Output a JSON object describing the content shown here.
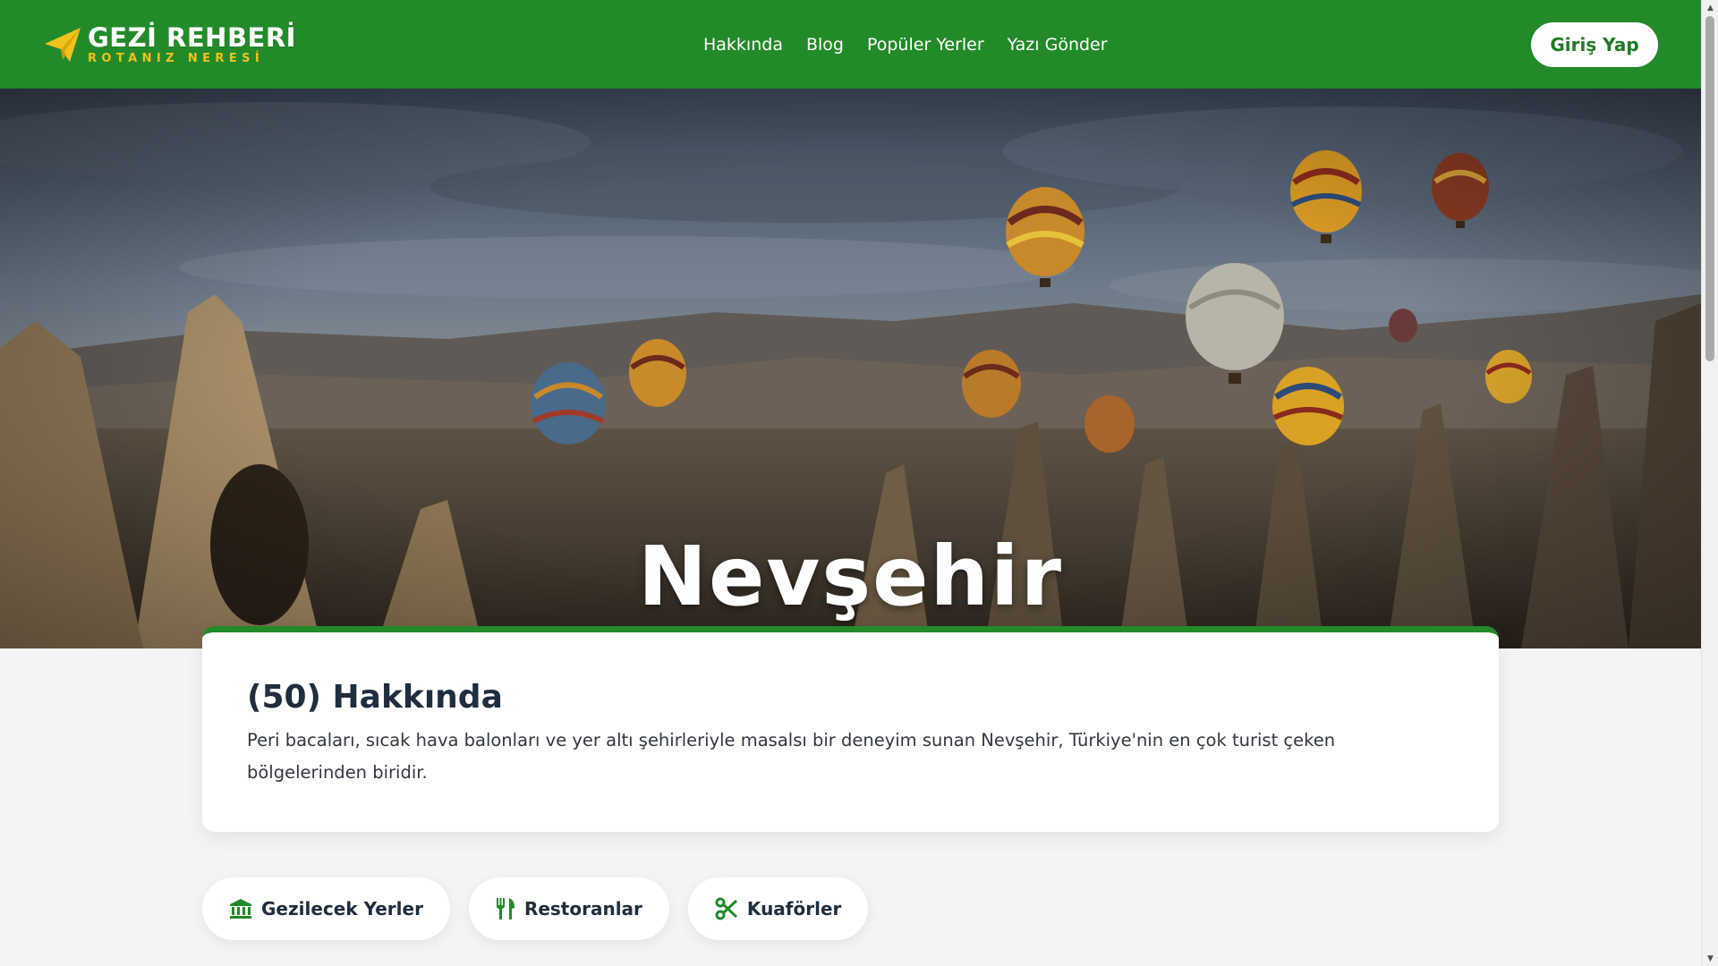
{
  "header": {
    "logo_title": "GEZİ REHBERİ",
    "logo_tagline": "ROTANIZ NERESİ",
    "nav": [
      {
        "label": "Hakkında"
      },
      {
        "label": "Blog"
      },
      {
        "label": "Popüler Yerler"
      },
      {
        "label": "Yazı Gönder"
      }
    ],
    "login_label": "Giriş Yap"
  },
  "hero": {
    "title": "Nevşehir"
  },
  "about": {
    "title": "(50) Hakkında",
    "text": "Peri bacaları, sıcak hava balonları ve yer altı şehirleriyle masalsı bir deneyim sunan Nevşehir, Türkiye'nin en çok turist çeken bölgelerinden biridir."
  },
  "categories": [
    {
      "label": "Gezilecek Yerler",
      "icon": "landmark-icon"
    },
    {
      "label": "Restoranlar",
      "icon": "utensils-icon"
    },
    {
      "label": "Kuaförler",
      "icon": "scissors-icon"
    }
  ],
  "colors": {
    "brand_green": "#238a2a",
    "accent_yellow": "#f2c21b",
    "heading": "#1f2d3d",
    "background": "#f3f4f6"
  }
}
